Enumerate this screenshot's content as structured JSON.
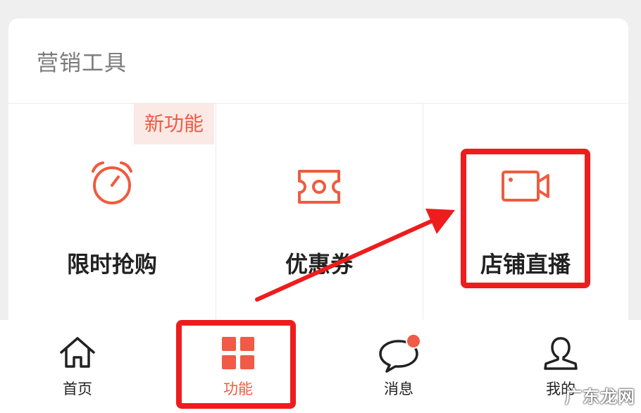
{
  "section": {
    "title": "营销工具"
  },
  "tools": [
    {
      "label": "限时抢购",
      "icon": "alarm-clock-icon",
      "badge": "新功能"
    },
    {
      "label": "优惠券",
      "icon": "coupon-ticket-icon"
    },
    {
      "label": "店铺直播",
      "icon": "video-camera-icon"
    }
  ],
  "tabbar": {
    "items": [
      {
        "label": "首页",
        "icon": "home-icon"
      },
      {
        "label": "功能",
        "icon": "grid-icon",
        "active": true
      },
      {
        "label": "消息",
        "icon": "chat-bubble-icon",
        "has_dot": true
      },
      {
        "label": "我的",
        "icon": "user-icon"
      }
    ]
  },
  "colors": {
    "accent": "#ef5b3f",
    "highlight": "#ee1c1c",
    "background": "#efefef"
  },
  "watermark": "广东龙网"
}
